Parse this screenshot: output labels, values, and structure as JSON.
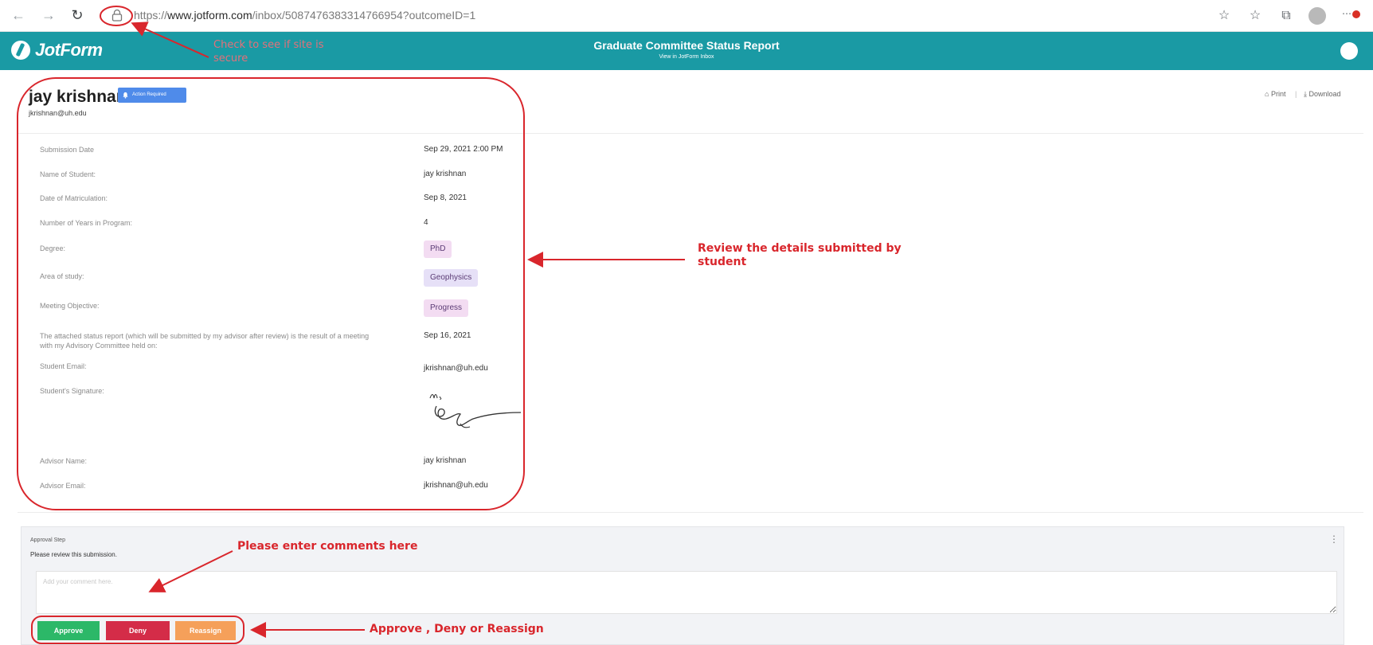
{
  "browser": {
    "url_prefix": "https://",
    "url_domain": "www.jotform.com",
    "url_path": "/inbox/5087476383314766954?outcomeID=1"
  },
  "header": {
    "logo": "JotForm",
    "title": "Graduate Committee Status Report",
    "subtitle": "View in JotForm Inbox"
  },
  "submission": {
    "name": "jay krishnan",
    "badge": "Action Required",
    "email": "jkrishnan@uh.edu",
    "actions": {
      "print": "Print",
      "separator": "|",
      "download": "Download"
    },
    "fields": [
      {
        "label": "Submission Date",
        "value": "Sep 29, 2021 2:00 PM"
      },
      {
        "label": "Name of Student:",
        "value": "jay krishnan"
      },
      {
        "label": "Date of Matriculation:",
        "value": "Sep 8, 2021"
      },
      {
        "label": "Number of Years in Program:",
        "value": "4"
      },
      {
        "label": "Degree:",
        "value": "PhD"
      },
      {
        "label": "Area of study:",
        "value": "Geophysics"
      },
      {
        "label": "Meeting Objective:",
        "value": "Progress"
      },
      {
        "label": "The attached status report (which will be submitted by my advisor after review) is the result of a meeting with my Advisory Committee held on:",
        "value": "Sep 16, 2021"
      },
      {
        "label": "Student Email:",
        "value": "jkrishnan@uh.edu"
      },
      {
        "label": "Student's Signature:",
        "value": ""
      },
      {
        "label": "Advisor Name:",
        "value": "jay krishnan"
      },
      {
        "label": "Advisor Email:",
        "value": "jkrishnan@uh.edu"
      }
    ]
  },
  "approval": {
    "step_label": "Approval Step",
    "description": "Please review this submission.",
    "more": "⋮",
    "comment_placeholder": "Add your comment here.",
    "buttons": {
      "approve": "Approve",
      "deny": "Deny",
      "reassign": "Reassign"
    }
  },
  "annotations": {
    "secure_check": "Check to see if site is secure",
    "review_details": "Review the details submitted by student",
    "enter_comments": "Please enter comments here",
    "approve_deny_reassign": "Approve , Deny or Reassign"
  },
  "colors": {
    "header_teal": "#1a9aa4",
    "annotation_red": "#d9262c",
    "approve_green": "#2cb868",
    "deny_red": "#d42c48",
    "reassign_orange": "#f5a05a",
    "badge_blue": "#4f8bea"
  },
  "icons": [
    "back-icon",
    "forward-icon",
    "reload-icon",
    "lock-icon",
    "favorites-add-icon",
    "favorites-icon",
    "collections-icon",
    "profile-icon",
    "notifications-icon",
    "home-icon",
    "download-icon",
    "bell-icon"
  ]
}
